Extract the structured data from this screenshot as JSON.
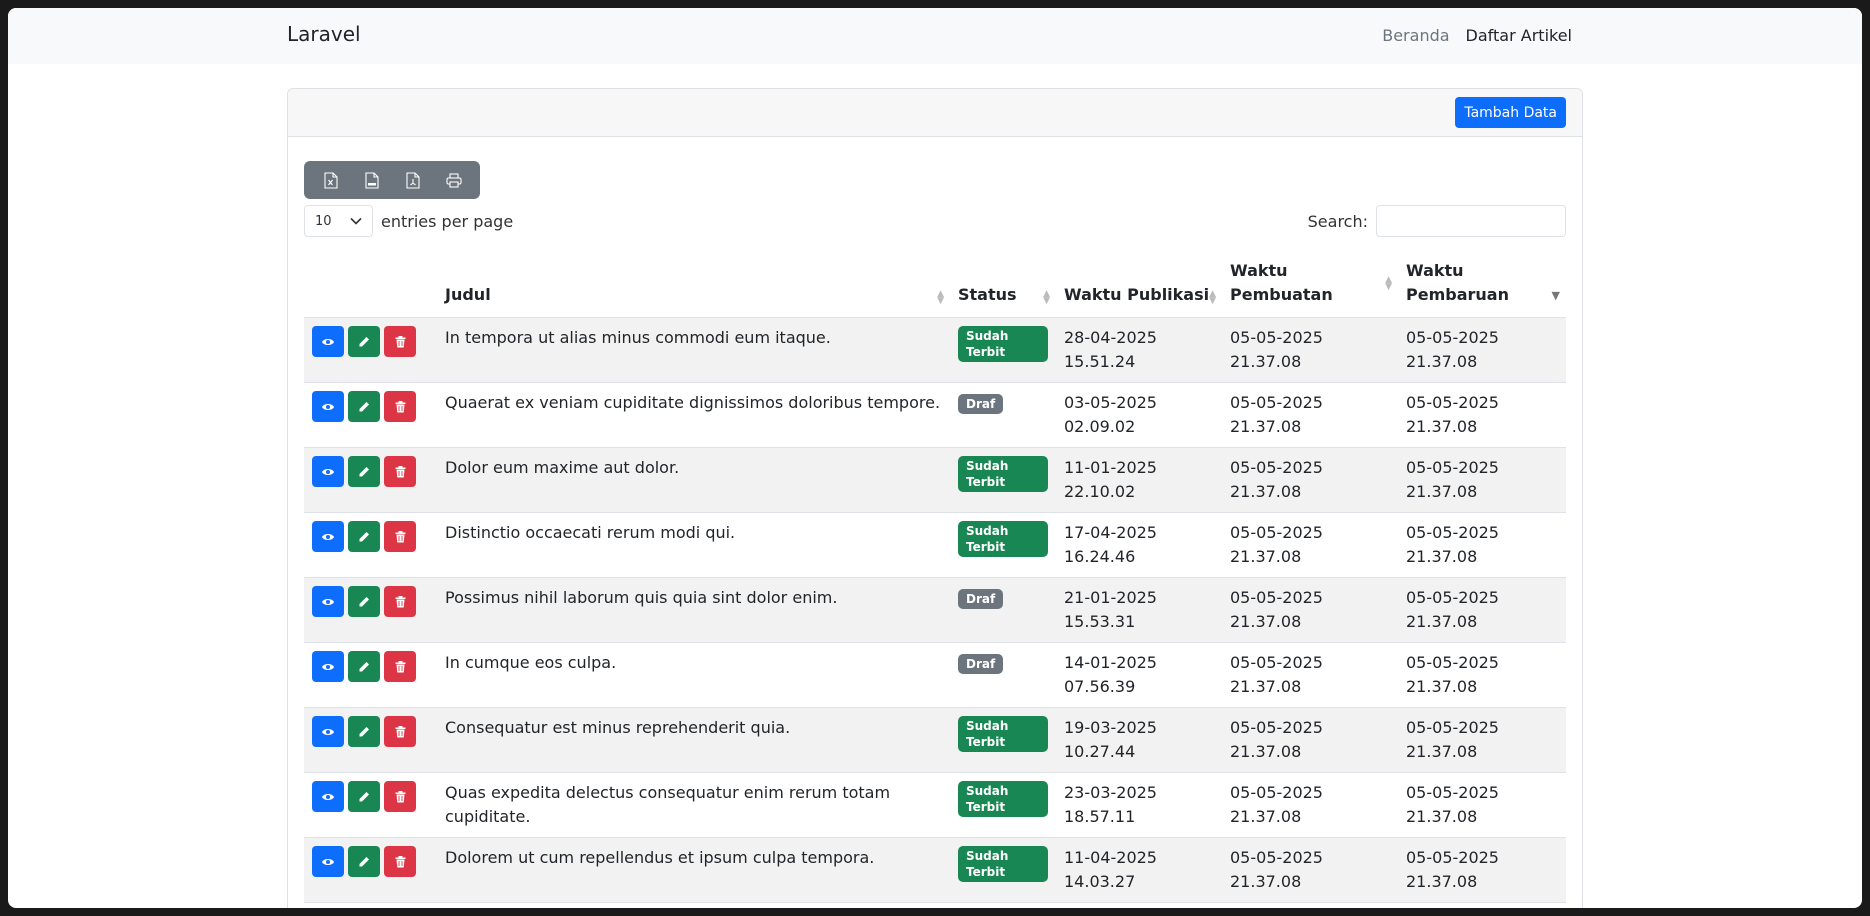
{
  "navbar": {
    "brand": "Laravel",
    "links": [
      {
        "label": "Beranda"
      },
      {
        "label": "Daftar Artikel"
      }
    ]
  },
  "card": {
    "add_button": "Tambah Data"
  },
  "toolbar": {
    "export_icons": [
      "excel-file-icon",
      "csv-file-icon",
      "pdf-file-icon",
      "printer-icon"
    ]
  },
  "controls": {
    "per_page_value": "10",
    "per_page_label": "entries per page",
    "search_label": "Search:",
    "search_value": ""
  },
  "table": {
    "headers": {
      "judul": "Judul",
      "status": "Status",
      "publikasi": "Waktu Publikasi",
      "pembuatan": "Waktu Pembuatan",
      "pembaruan": "Waktu Pembaruan"
    },
    "rows": [
      {
        "judul": "In tempora ut alias minus commodi eum itaque.",
        "status": "Sudah Terbit",
        "status_kind": "ok",
        "publikasi": "28-04-2025 15.51.24",
        "pembuatan": "05-05-2025 21.37.08",
        "pembaruan": "05-05-2025 21.37.08"
      },
      {
        "judul": "Quaerat ex veniam cupiditate dignissimos doloribus tempore.",
        "status": "Draf",
        "status_kind": "draft",
        "publikasi": "03-05-2025 02.09.02",
        "pembuatan": "05-05-2025 21.37.08",
        "pembaruan": "05-05-2025 21.37.08"
      },
      {
        "judul": "Dolor eum maxime aut dolor.",
        "status": "Sudah Terbit",
        "status_kind": "ok",
        "publikasi": "11-01-2025 22.10.02",
        "pembuatan": "05-05-2025 21.37.08",
        "pembaruan": "05-05-2025 21.37.08"
      },
      {
        "judul": "Distinctio occaecati rerum modi qui.",
        "status": "Sudah Terbit",
        "status_kind": "ok",
        "publikasi": "17-04-2025 16.24.46",
        "pembuatan": "05-05-2025 21.37.08",
        "pembaruan": "05-05-2025 21.37.08"
      },
      {
        "judul": "Possimus nihil laborum quis quia sint dolor enim.",
        "status": "Draf",
        "status_kind": "draft",
        "publikasi": "21-01-2025 15.53.31",
        "pembuatan": "05-05-2025 21.37.08",
        "pembaruan": "05-05-2025 21.37.08"
      },
      {
        "judul": "In cumque eos culpa.",
        "status": "Draf",
        "status_kind": "draft",
        "publikasi": "14-01-2025 07.56.39",
        "pembuatan": "05-05-2025 21.37.08",
        "pembaruan": "05-05-2025 21.37.08"
      },
      {
        "judul": "Consequatur est minus reprehenderit quia.",
        "status": "Sudah Terbit",
        "status_kind": "ok",
        "publikasi": "19-03-2025 10.27.44",
        "pembuatan": "05-05-2025 21.37.08",
        "pembaruan": "05-05-2025 21.37.08"
      },
      {
        "judul": "Quas expedita delectus consequatur enim rerum totam cupiditate.",
        "status": "Sudah Terbit",
        "status_kind": "ok",
        "publikasi": "23-03-2025 18.57.11",
        "pembuatan": "05-05-2025 21.37.08",
        "pembaruan": "05-05-2025 21.37.08"
      },
      {
        "judul": "Dolorem ut cum repellendus et ipsum culpa tempora.",
        "status": "Sudah Terbit",
        "status_kind": "ok",
        "publikasi": "11-04-2025 14.03.27",
        "pembuatan": "05-05-2025 21.37.08",
        "pembaruan": "05-05-2025 21.37.08"
      }
    ]
  }
}
